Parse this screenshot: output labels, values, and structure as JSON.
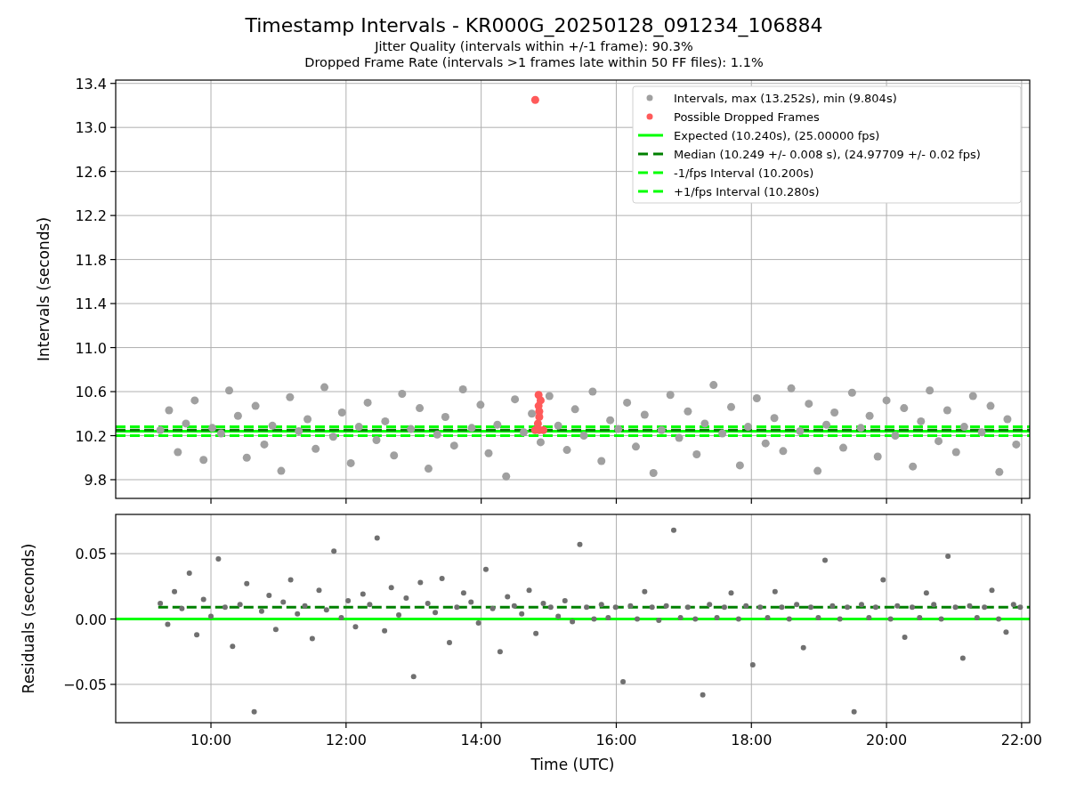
{
  "title": "Timestamp Intervals - KR000G_20250128_091234_106884",
  "subtitles": [
    "Jitter Quality (intervals within +/-1 frame): 90.3%",
    "Dropped Frame Rate (intervals >1 frames late within 50 FF files): 1.1%"
  ],
  "charts": [
    {
      "chart_data": {
        "type": "scatter",
        "ylabel": "Intervals (seconds)",
        "xlim": [
          8.59,
          22.12
        ],
        "ylim": [
          9.63,
          13.43
        ],
        "grid": true,
        "yticks": [
          {
            "value": 9.8,
            "label": "9.8"
          },
          {
            "value": 10.2,
            "label": "10.2"
          },
          {
            "value": 10.6,
            "label": "10.6"
          },
          {
            "value": 11.0,
            "label": "11.0"
          },
          {
            "value": 11.4,
            "label": "11.4"
          },
          {
            "value": 11.8,
            "label": "11.8"
          },
          {
            "value": 12.2,
            "label": "12.2"
          },
          {
            "value": 12.6,
            "label": "12.6"
          },
          {
            "value": 13.0,
            "label": "13.0"
          },
          {
            "value": 13.4,
            "label": "13.4"
          }
        ],
        "series": [
          {
            "name": "Intervals, max (13.252s), min (9.804s)",
            "color": "#a0a0a0",
            "x": [
              9.25,
              9.38,
              9.51,
              9.63,
              9.76,
              9.89,
              10.02,
              10.15,
              10.27,
              10.4,
              10.53,
              10.66,
              10.79,
              10.91,
              11.04,
              11.17,
              11.3,
              11.43,
              11.55,
              11.68,
              11.81,
              11.94,
              12.07,
              12.19,
              12.32,
              12.45,
              12.58,
              12.71,
              12.83,
              12.96,
              13.09,
              13.22,
              13.35,
              13.47,
              13.6,
              13.73,
              13.86,
              13.99,
              14.11,
              14.24,
              14.37,
              14.5,
              14.63,
              14.75,
              14.88,
              15.01,
              15.14,
              15.27,
              15.39,
              15.52,
              15.65,
              15.78,
              15.91,
              16.03,
              16.16,
              16.29,
              16.42,
              16.55,
              16.67,
              16.8,
              16.93,
              17.06,
              17.19,
              17.31,
              17.44,
              17.57,
              17.7,
              17.83,
              17.95,
              18.08,
              18.21,
              18.34,
              18.47,
              18.59,
              18.72,
              18.85,
              18.98,
              19.11,
              19.23,
              19.36,
              19.49,
              19.62,
              19.75,
              19.87,
              20.0,
              20.13,
              20.26,
              20.39,
              20.51,
              20.64,
              20.77,
              20.9,
              21.03,
              21.15,
              21.28,
              21.41,
              21.54,
              21.67,
              21.79,
              21.92
            ],
            "values": [
              10.25,
              10.43,
              10.05,
              10.31,
              10.52,
              9.98,
              10.27,
              10.22,
              10.61,
              10.38,
              10.0,
              10.47,
              10.12,
              10.29,
              9.88,
              10.55,
              10.24,
              10.35,
              10.08,
              10.64,
              10.19,
              10.41,
              9.95,
              10.28,
              10.5,
              10.16,
              10.33,
              10.02,
              10.58,
              10.26,
              10.45,
              9.9,
              10.21,
              10.37,
              10.11,
              10.62,
              10.27,
              10.48,
              10.04,
              10.3,
              9.83,
              10.53,
              10.23,
              10.4,
              10.14,
              10.56,
              10.29,
              10.07,
              10.44,
              10.2,
              10.6,
              9.97,
              10.34,
              10.26,
              10.5,
              10.1,
              10.39,
              9.86,
              10.25,
              10.57,
              10.18,
              10.42,
              10.03,
              10.31,
              10.66,
              10.22,
              10.46,
              9.93,
              10.28,
              10.54,
              10.13,
              10.36,
              10.06,
              10.63,
              10.24,
              10.49,
              9.88,
              10.3,
              10.41,
              10.09,
              10.59,
              10.27,
              10.38,
              10.01,
              10.52,
              10.2,
              10.45,
              9.92,
              10.33,
              10.61,
              10.15,
              10.43,
              10.05,
              10.28,
              10.56,
              10.23,
              10.47,
              9.87,
              10.35,
              10.12
            ]
          },
          {
            "name": "Possible Dropped Frames",
            "color": "#ff5a5a",
            "x": [
              14.8,
              14.85,
              14.88,
              14.85,
              14.86,
              14.86,
              14.84,
              14.8,
              14.86,
              14.92
            ],
            "values": [
              13.25,
              10.57,
              10.52,
              10.47,
              10.42,
              10.37,
              10.31,
              10.25,
              10.25,
              10.25
            ]
          },
          {
            "name": "Expected (10.240s), (25.00000 fps)",
            "type": "line",
            "line_style": "solid",
            "color": "#00ff00",
            "x": [
              8.59,
              22.12
            ],
            "values": [
              10.24,
              10.24
            ]
          },
          {
            "name": "Median (10.249 +/- 0.008 s), (24.97709 +/- 0.02 fps)",
            "type": "line",
            "line_style": "dashed",
            "color": "#008000",
            "x": [
              8.59,
              22.12
            ],
            "values": [
              10.25,
              10.25
            ]
          },
          {
            "name": "-1/fps Interval (10.200s)",
            "type": "line",
            "line_style": "dashed",
            "color": "#00ff00",
            "x": [
              8.59,
              22.12
            ],
            "values": [
              10.2,
              10.2
            ]
          },
          {
            "name": "+1/fps Interval (10.280s)",
            "type": "line",
            "line_style": "dashed",
            "color": "#00ff00",
            "x": [
              8.59,
              22.12
            ],
            "values": [
              10.28,
              10.28
            ]
          }
        ],
        "legend": true
      }
    },
    {
      "chart_data": {
        "type": "scatter",
        "ylabel": "Residuals (seconds)",
        "xlabel": "Time (UTC)",
        "xlim": [
          8.59,
          22.12
        ],
        "ylim": [
          -0.0793,
          0.08
        ],
        "grid": true,
        "xticks": [
          {
            "value": 10,
            "label": "10:00"
          },
          {
            "value": 12,
            "label": "12:00"
          },
          {
            "value": 14,
            "label": "14:00"
          },
          {
            "value": 16,
            "label": "16:00"
          },
          {
            "value": 18,
            "label": "18:00"
          },
          {
            "value": 20,
            "label": "20:00"
          },
          {
            "value": 22,
            "label": "22:00"
          }
        ],
        "yticks": [
          {
            "value": -0.05,
            "label": "−0.05"
          },
          {
            "value": 0,
            "label": "0.00"
          },
          {
            "value": 0.05,
            "label": "0.05"
          }
        ],
        "series": [
          {
            "type": "line",
            "line_style": "dashed",
            "color": "#008000",
            "x": [
              9.22,
              22.12
            ],
            "values": [
              0.009,
              0.009
            ]
          },
          {
            "type": "line",
            "line_style": "solid",
            "color": "#00ff00",
            "x": [
              8.59,
              22.12
            ],
            "values": [
              0,
              0
            ]
          },
          {
            "color": "#707070",
            "x": [
              9.25,
              9.36,
              9.46,
              9.57,
              9.68,
              9.79,
              9.89,
              10.0,
              10.11,
              10.21,
              10.32,
              10.43,
              10.53,
              10.64,
              10.75,
              10.86,
              10.96,
              11.07,
              11.18,
              11.28,
              11.39,
              11.5,
              11.6,
              11.71,
              11.82,
              11.93,
              12.03,
              12.14,
              12.25,
              12.35,
              12.46,
              12.57,
              12.67,
              12.78,
              12.89,
              13.0,
              13.1,
              13.21,
              13.32,
              13.42,
              13.53,
              13.64,
              13.74,
              13.85,
              13.96,
              14.07,
              14.17,
              14.28,
              14.39,
              14.49,
              14.6,
              14.71,
              14.81,
              14.92,
              15.03,
              15.14,
              15.24,
              15.35,
              15.46,
              15.56,
              15.67,
              15.78,
              15.88,
              15.99,
              16.1,
              16.21,
              16.31,
              16.42,
              16.53,
              16.63,
              16.74,
              16.85,
              16.95,
              17.06,
              17.17,
              17.28,
              17.38,
              17.49,
              17.6,
              17.7,
              17.81,
              17.92,
              18.02,
              18.13,
              18.24,
              18.35,
              18.45,
              18.56,
              18.67,
              18.77,
              18.88,
              18.99,
              19.09,
              19.2,
              19.31,
              19.42,
              19.52,
              19.63,
              19.74,
              19.84,
              19.95,
              20.06,
              20.16,
              20.27,
              20.38,
              20.49,
              20.59,
              20.7,
              20.81,
              20.91,
              21.02,
              21.13,
              21.23,
              21.34,
              21.45,
              21.56,
              21.66,
              21.77,
              21.88,
              21.98
            ],
            "values": [
              0.012,
              -0.004,
              0.021,
              0.008,
              0.035,
              -0.012,
              0.015,
              0.002,
              0.046,
              0.009,
              -0.021,
              0.011,
              0.027,
              -0.071,
              0.006,
              0.018,
              -0.008,
              0.013,
              0.03,
              0.004,
              0.01,
              -0.015,
              0.022,
              0.007,
              0.052,
              0.001,
              0.014,
              -0.006,
              0.019,
              0.011,
              0.062,
              -0.009,
              0.024,
              0.003,
              0.016,
              -0.044,
              0.028,
              0.012,
              0.005,
              0.031,
              -0.018,
              0.009,
              0.02,
              0.013,
              -0.003,
              0.038,
              0.008,
              -0.025,
              0.017,
              0.01,
              0.004,
              0.022,
              -0.011,
              0.012,
              0.009,
              0.002,
              0.014,
              -0.002,
              0.057,
              0.009,
              0.0,
              0.011,
              0.001,
              0.009,
              -0.048,
              0.01,
              0.0,
              0.021,
              0.009,
              -0.001,
              0.01,
              0.068,
              0.001,
              0.009,
              0.0,
              -0.058,
              0.011,
              0.001,
              0.009,
              0.02,
              0.0,
              0.01,
              -0.035,
              0.009,
              0.001,
              0.021,
              0.009,
              0.0,
              0.011,
              -0.022,
              0.009,
              0.001,
              0.045,
              0.01,
              0.0,
              0.009,
              -0.071,
              0.011,
              0.001,
              0.009,
              0.03,
              0.0,
              0.01,
              -0.014,
              0.009,
              0.001,
              0.02,
              0.011,
              0.0,
              0.048,
              0.009,
              -0.03,
              0.01,
              0.001,
              0.009,
              0.022,
              0.0,
              -0.01,
              0.011,
              0.009
            ]
          }
        ]
      }
    }
  ]
}
